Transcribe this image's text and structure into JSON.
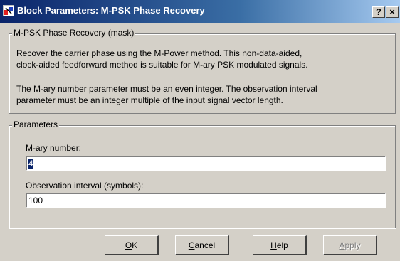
{
  "window": {
    "title": "Block Parameters: M-PSK Phase Recovery",
    "help_button": "?",
    "close_button": "×"
  },
  "mask_group": {
    "legend": "M-PSK Phase Recovery (mask)",
    "description_1_line1": "Recover the carrier phase using the M-Power method.  This non-data-aided,",
    "description_1_line2": "clock-aided feedforward method is suitable for M-ary PSK modulated signals.",
    "description_2_line1": "The M-ary number parameter must be an even integer. The observation interval",
    "description_2_line2": "parameter must be an integer multiple of the input signal vector length."
  },
  "params_group": {
    "legend": "Parameters",
    "mary_label": "M-ary number:",
    "mary_value": "4",
    "obs_label": "Observation interval (symbols):",
    "obs_value": "100"
  },
  "buttons": {
    "ok": "OK",
    "cancel": "Cancel",
    "help": "Help",
    "apply": "Apply",
    "ok_mnemonic": "O",
    "ok_rest": "K",
    "cancel_mnemonic": "C",
    "cancel_rest": "ancel",
    "help_mnemonic": "H",
    "help_rest": "elp",
    "apply_mnemonic": "A",
    "apply_rest": "pply",
    "apply_enabled": false
  },
  "icons": {
    "app_icon": "simulink-block-icon"
  },
  "colors": {
    "title_gradient_start": "#0a246a",
    "title_gradient_end": "#a6caf0",
    "face": "#d4d0c8"
  }
}
